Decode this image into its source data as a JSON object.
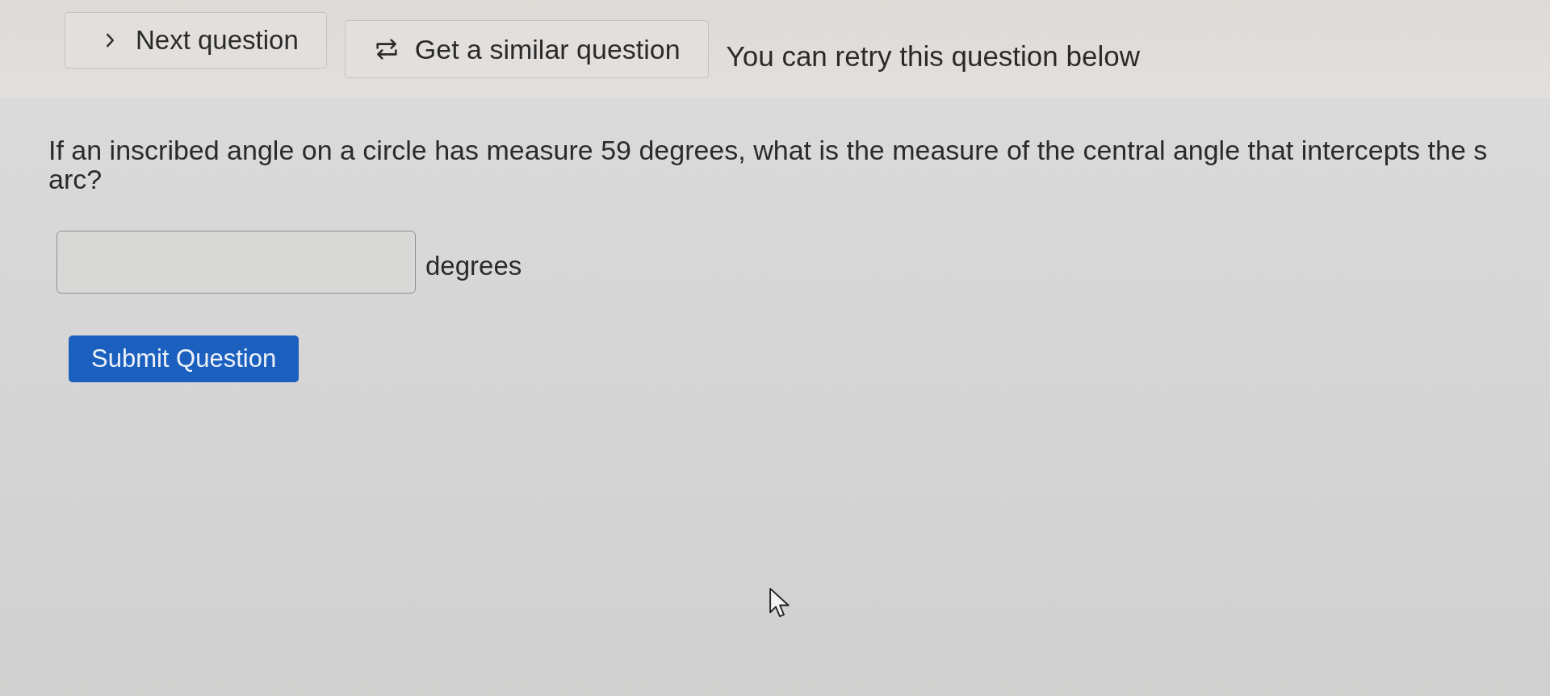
{
  "toolbar": {
    "buttons": [
      {
        "kind": "next",
        "label": "Next question"
      },
      {
        "kind": "similar",
        "label": "Get a similar question"
      }
    ],
    "message": "You can retry this question below"
  },
  "question": {
    "lines": [
      "If an inscribed angle on a circle has measure 59 degrees, what is the measure of the central angle that intercepts the s",
      "arc?"
    ]
  },
  "answer": {
    "unit": "degrees"
  },
  "submit_button": {
    "label": "Submit Question"
  }
}
